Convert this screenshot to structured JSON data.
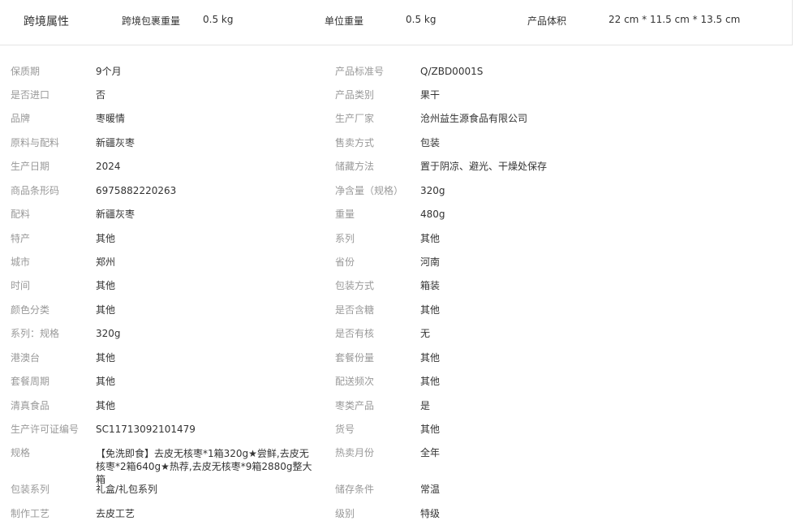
{
  "cross_border": {
    "title": "跨境属性",
    "package_weight_label": "跨境包裹重量",
    "package_weight_value": "0.5 kg",
    "unit_weight_label": "单位重量",
    "unit_weight_value": "0.5 kg",
    "volume_label": "产品体积",
    "volume_value": "22 cm * 11.5 cm * 13.5 cm"
  },
  "attributes": {
    "left": [
      {
        "label": "保质期",
        "value": "9个月"
      },
      {
        "label": "是否进口",
        "value": "否"
      },
      {
        "label": "品牌",
        "value": "枣暖情"
      },
      {
        "label": "原料与配料",
        "value": "新疆灰枣"
      },
      {
        "label": "生产日期",
        "value": "2024"
      },
      {
        "label": "商品条形码",
        "value": "6975882220263"
      },
      {
        "label": "配料",
        "value": "新疆灰枣"
      },
      {
        "label": "特产",
        "value": "其他"
      },
      {
        "label": "城市",
        "value": "郑州"
      },
      {
        "label": "时间",
        "value": "其他"
      },
      {
        "label": "颜色分类",
        "value": "其他"
      },
      {
        "label": "系列：规格",
        "value": "320g"
      },
      {
        "label": "港澳台",
        "value": "其他"
      },
      {
        "label": "套餐周期",
        "value": "其他"
      },
      {
        "label": "清真食品",
        "value": "其他"
      },
      {
        "label": "生产许可证编号",
        "value": "SC11713092101479"
      },
      {
        "label": "规格",
        "value": "【免洗即食】去皮无核枣*1箱320g★尝鲜,去皮无核枣*2箱640g★热荐,去皮无核枣*9箱2880g整大箱"
      },
      {
        "label": "包装系列",
        "value": "礼盒/礼包系列"
      },
      {
        "label": "制作工艺",
        "value": "去皮工艺"
      }
    ],
    "right": [
      {
        "label": "产品标准号",
        "value": "Q/ZBD0001S"
      },
      {
        "label": "产品类别",
        "value": "果干"
      },
      {
        "label": "生产厂家",
        "value": "沧州益生源食品有限公司"
      },
      {
        "label": "售卖方式",
        "value": "包装"
      },
      {
        "label": "储藏方法",
        "value": "置于阴凉、避光、干燥处保存"
      },
      {
        "label": "净含量（规格）",
        "value": "320g"
      },
      {
        "label": "重量",
        "value": "480g"
      },
      {
        "label": "系列",
        "value": "其他"
      },
      {
        "label": "省份",
        "value": "河南"
      },
      {
        "label": "包装方式",
        "value": "箱装"
      },
      {
        "label": "是否含糖",
        "value": "其他"
      },
      {
        "label": "是否有核",
        "value": "无"
      },
      {
        "label": "套餐份量",
        "value": "其他"
      },
      {
        "label": "配送频次",
        "value": "其他"
      },
      {
        "label": "枣类产品",
        "value": "是"
      },
      {
        "label": "货号",
        "value": "其他"
      },
      {
        "label": "热卖月份",
        "value": "全年"
      },
      {
        "label": "储存条件",
        "value": "常温"
      },
      {
        "label": "级别",
        "value": "特级"
      }
    ]
  }
}
